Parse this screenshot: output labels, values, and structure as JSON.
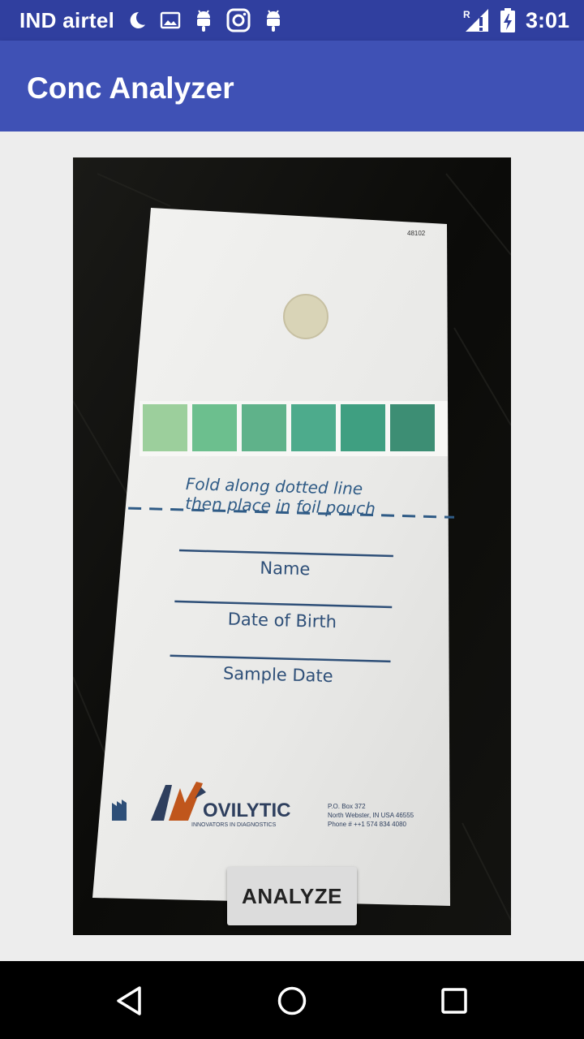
{
  "status_bar": {
    "carrier": "IND airtel",
    "time": "3:01",
    "left_icons": [
      "moon-icon",
      "image-notification-icon",
      "android-notification-icon",
      "instagram-icon",
      "android-notification-icon"
    ],
    "right_icons": [
      "signal-roaming-icon",
      "battery-charging-icon"
    ]
  },
  "app_bar": {
    "title": "Conc Analyzer",
    "color": "#3f51b5",
    "status_color": "#303f9f"
  },
  "photo": {
    "card_code": "48102",
    "instruction_line1": "Fold along dotted line",
    "instruction_line2": "then place in foil pouch",
    "field_name": "Name",
    "field_dob": "Date of Birth",
    "field_sample_date": "Sample Date",
    "brand": "OVILYTIC",
    "brand_tagline": "INNOVATORS IN DIAGNOSTICS",
    "address_line1": "P.O. Box 372",
    "address_line2": "North Webster, IN  USA 46555",
    "address_line3": "Phone # ++1 574 834 4080",
    "swatch_colors": [
      "#9ccf9c",
      "#6cbf8e",
      "#5fb28a",
      "#4dab8c",
      "#3f9f81",
      "#3d8e74"
    ]
  },
  "actions": {
    "analyze_label": "ANALYZE"
  },
  "nav_bar": {
    "icons": [
      "back-icon",
      "home-icon",
      "recents-icon"
    ]
  }
}
